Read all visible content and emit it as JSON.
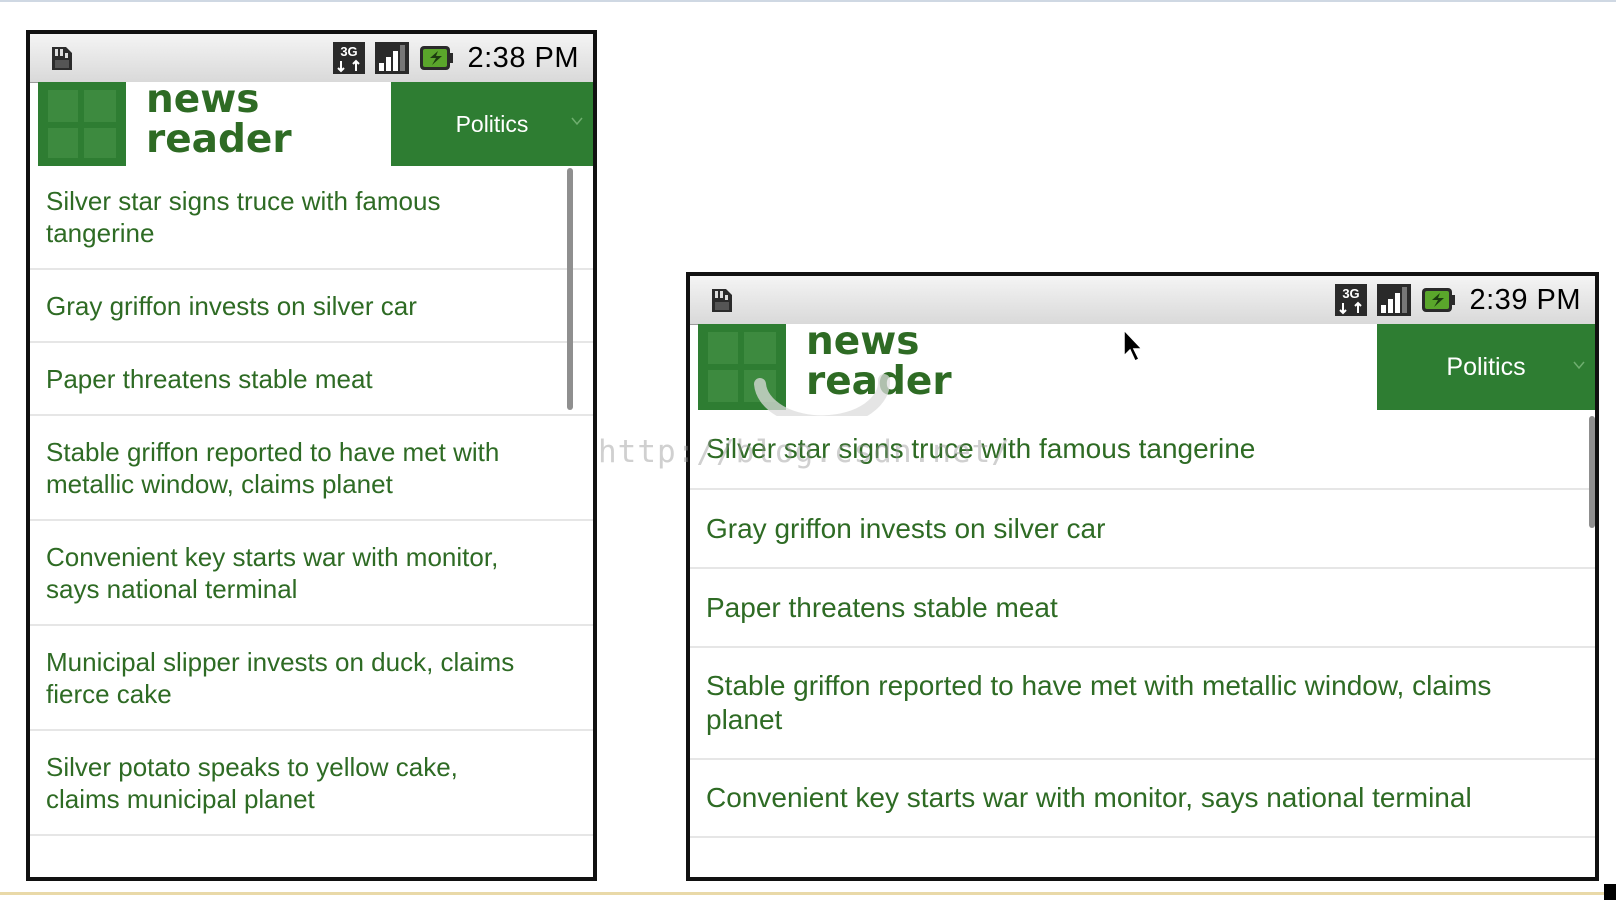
{
  "watermark": "http://blog.csdn.net/",
  "colors": {
    "accent_green": "#2e7d32",
    "headline_text": "#2e6b24",
    "status_bar": "#e3e3e3"
  },
  "icons": {
    "status_left": "sd-card-icon",
    "status_right": [
      "3g-icon",
      "signal-icon",
      "battery-charging-icon"
    ],
    "pointer": "mouse-cursor-icon"
  },
  "screens": [
    {
      "status_time": "2:38 PM",
      "app_logo_line1": "news",
      "app_logo_line2": "reader",
      "section_label": "Politics",
      "headlines": [
        "Silver star signs truce with famous tangerine",
        "Gray griffon invests on silver car",
        "Paper threatens stable meat",
        "Stable griffon reported to have met with metallic window, claims planet",
        "Convenient key starts war with monitor, says national terminal",
        "Municipal slipper invests on duck, claims fierce cake",
        "Silver potato speaks to yellow cake, claims municipal planet"
      ]
    },
    {
      "status_time": "2:39 PM",
      "app_logo_line1": "news",
      "app_logo_line2": "reader",
      "section_label": "Politics",
      "headlines": [
        "Silver star signs truce with famous tangerine",
        "Gray griffon invests on silver car",
        "Paper threatens stable meat",
        "Stable griffon reported to have met with metallic window, claims planet",
        "Convenient key starts war with monitor, says national terminal"
      ]
    }
  ]
}
